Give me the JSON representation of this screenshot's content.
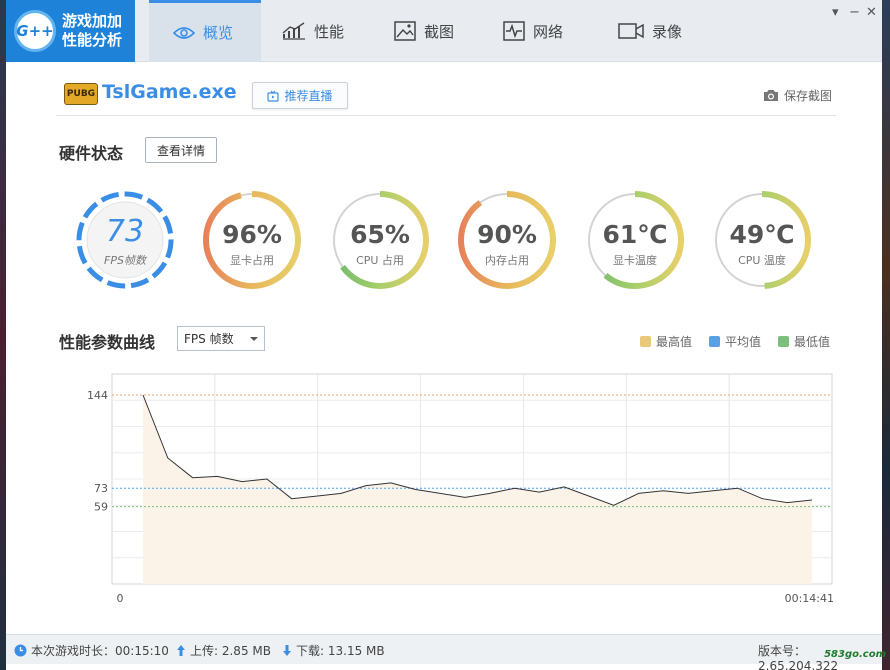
{
  "app": {
    "logo_text_line1": "游戏加加",
    "logo_text_line2": "性能分析",
    "logo_badge": "G++"
  },
  "nav": {
    "tabs": [
      {
        "label": "概览",
        "icon": "eye-icon",
        "active": true
      },
      {
        "label": "性能",
        "icon": "bar-chart-icon",
        "active": false
      },
      {
        "label": "截图",
        "icon": "picture-icon",
        "active": false
      },
      {
        "label": "网络",
        "icon": "pulse-icon",
        "active": false
      },
      {
        "label": "录像",
        "icon": "video-camera-icon",
        "active": false
      }
    ]
  },
  "window_controls": {
    "minimize": "▾",
    "restore": "−",
    "close": "✕"
  },
  "game": {
    "badge": "PUBG",
    "exe": "TslGame.exe",
    "recommend_label": "推荐直播",
    "screenshot_label": "保存截图"
  },
  "hardware": {
    "title": "硬件状态",
    "detail_button": "查看详情",
    "gauges": [
      {
        "value": "73",
        "label": "FPS帧数",
        "fraction": 1.0
      },
      {
        "value": "96%",
        "label": "显卡占用",
        "fraction": 0.96
      },
      {
        "value": "65%",
        "label": "CPU 占用",
        "fraction": 0.65
      },
      {
        "value": "90%",
        "label": "内存占用",
        "fraction": 0.9
      },
      {
        "value": "61℃",
        "label": "显卡温度",
        "fraction": 0.61
      },
      {
        "value": "49℃",
        "label": "CPU 温度",
        "fraction": 0.49
      }
    ]
  },
  "curve": {
    "title": "性能参数曲线",
    "select_value": "FPS 帧数",
    "legend": [
      {
        "label": "最高值",
        "color": "#e8c87a"
      },
      {
        "label": "平均值",
        "color": "#5aa0e6"
      },
      {
        "label": "最低值",
        "color": "#7cbf7c"
      }
    ]
  },
  "chart_data": {
    "type": "area",
    "x_start_label": "0",
    "x_end_label": "00:14:41",
    "y_ticks": [
      144,
      73,
      59
    ],
    "ylim": [
      0,
      160
    ],
    "reference_lines": [
      {
        "name": "最高值",
        "value": 144,
        "color": "#e8a37a"
      },
      {
        "name": "平均值",
        "value": 73,
        "color": "#5aa0e6"
      },
      {
        "name": "最低值",
        "value": 59,
        "color": "#7cbf7c"
      }
    ],
    "values": [
      144,
      96,
      81,
      82,
      78,
      80,
      65,
      67,
      69,
      75,
      77,
      72,
      69,
      66,
      69,
      73,
      70,
      74,
      67,
      60,
      69,
      71,
      69,
      71,
      73,
      65,
      62,
      64
    ],
    "grid": true
  },
  "status": {
    "play_time": "本次游戏时长：00:15:10",
    "upload": "上传: 2.85 MB",
    "download": "下载: 13.15 MB",
    "version": "版本号：2.65.204.322"
  },
  "watermark": "583go.com"
}
